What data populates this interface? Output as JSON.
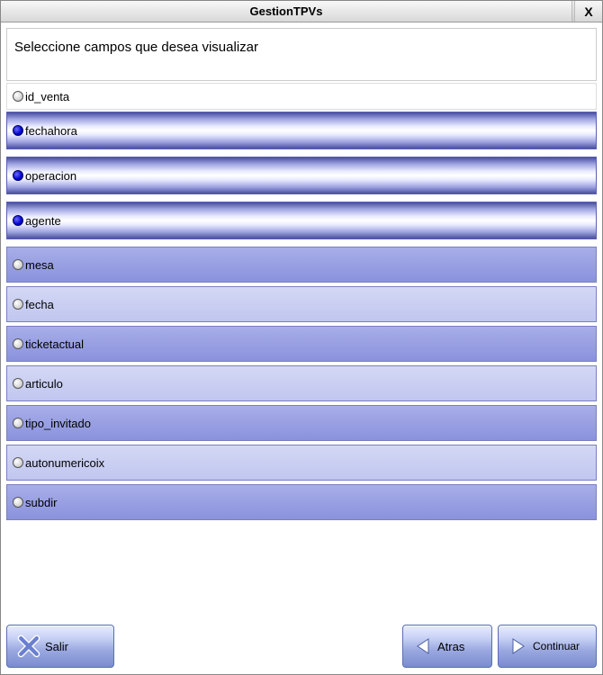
{
  "window": {
    "title": "GestionTPVs",
    "close_label": "X"
  },
  "prompt": "Seleccione campos que desea visualizar",
  "fields": [
    {
      "name": "id_venta",
      "selected": false,
      "style": "plain"
    },
    {
      "name": "fechahora",
      "selected": true,
      "style": "selected"
    },
    {
      "name": "operacion",
      "selected": true,
      "style": "selected"
    },
    {
      "name": "agente",
      "selected": true,
      "style": "selected"
    },
    {
      "name": "mesa",
      "selected": false,
      "style": "alt-a"
    },
    {
      "name": "fecha",
      "selected": false,
      "style": "alt-b"
    },
    {
      "name": "ticketactual",
      "selected": false,
      "style": "alt-a"
    },
    {
      "name": "articulo",
      "selected": false,
      "style": "alt-b"
    },
    {
      "name": "tipo_invitado",
      "selected": false,
      "style": "alt-a"
    },
    {
      "name": "autonumericoix",
      "selected": false,
      "style": "alt-b"
    },
    {
      "name": "subdir",
      "selected": false,
      "style": "alt-a"
    }
  ],
  "buttons": {
    "salir": "Salir",
    "atras": "Atras",
    "continuar": "Continuar"
  }
}
